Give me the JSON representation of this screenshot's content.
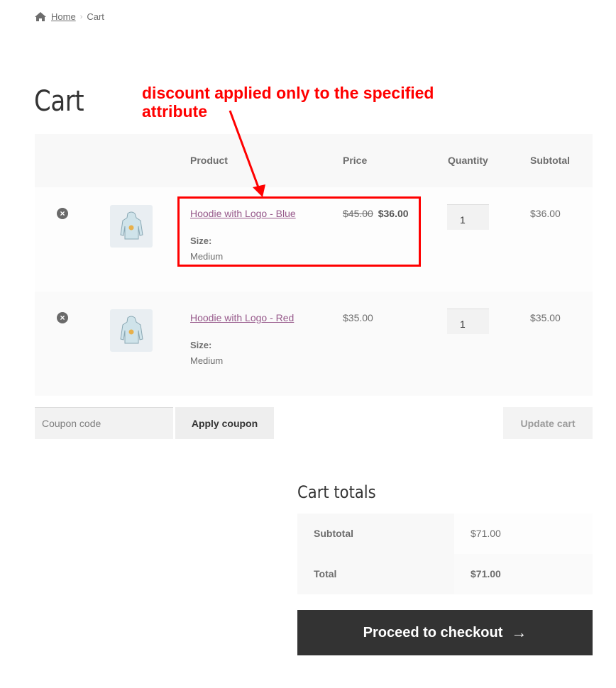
{
  "breadcrumb": {
    "home_icon": "home-icon",
    "home": "Home",
    "separator": "›",
    "current": "Cart"
  },
  "page": {
    "title": "Cart"
  },
  "annotation": {
    "text": "discount applied only to the specified attribute",
    "color": "#ff0000"
  },
  "table": {
    "headers": {
      "product": "Product",
      "price": "Price",
      "quantity": "Quantity",
      "subtotal": "Subtotal"
    },
    "rows": [
      {
        "remove_icon": "remove-circle-x-icon",
        "thumbnail": "hoodie-image",
        "name": "Hoodie with Logo - Blue",
        "attr_label": "Size:",
        "attr_value": "Medium",
        "regular_price": "$45.00",
        "sale_price": "$36.00",
        "quantity": "1",
        "subtotal": "$36.00"
      },
      {
        "remove_icon": "remove-circle-x-icon",
        "thumbnail": "hoodie-image",
        "name": "Hoodie with Logo - Red",
        "attr_label": "Size:",
        "attr_value": "Medium",
        "price": "$35.00",
        "quantity": "1",
        "subtotal": "$35.00"
      }
    ]
  },
  "actions": {
    "coupon_placeholder": "Coupon code",
    "coupon_value": "",
    "apply_coupon": "Apply coupon",
    "update_cart": "Update cart"
  },
  "totals": {
    "title": "Cart totals",
    "subtotal_label": "Subtotal",
    "subtotal_value": "$71.00",
    "total_label": "Total",
    "total_value": "$71.00"
  },
  "checkout": {
    "label": "Proceed to checkout",
    "icon": "→"
  },
  "colors": {
    "link": "#96588a",
    "checkout_bg": "#333333",
    "annotation": "#ff0000"
  }
}
